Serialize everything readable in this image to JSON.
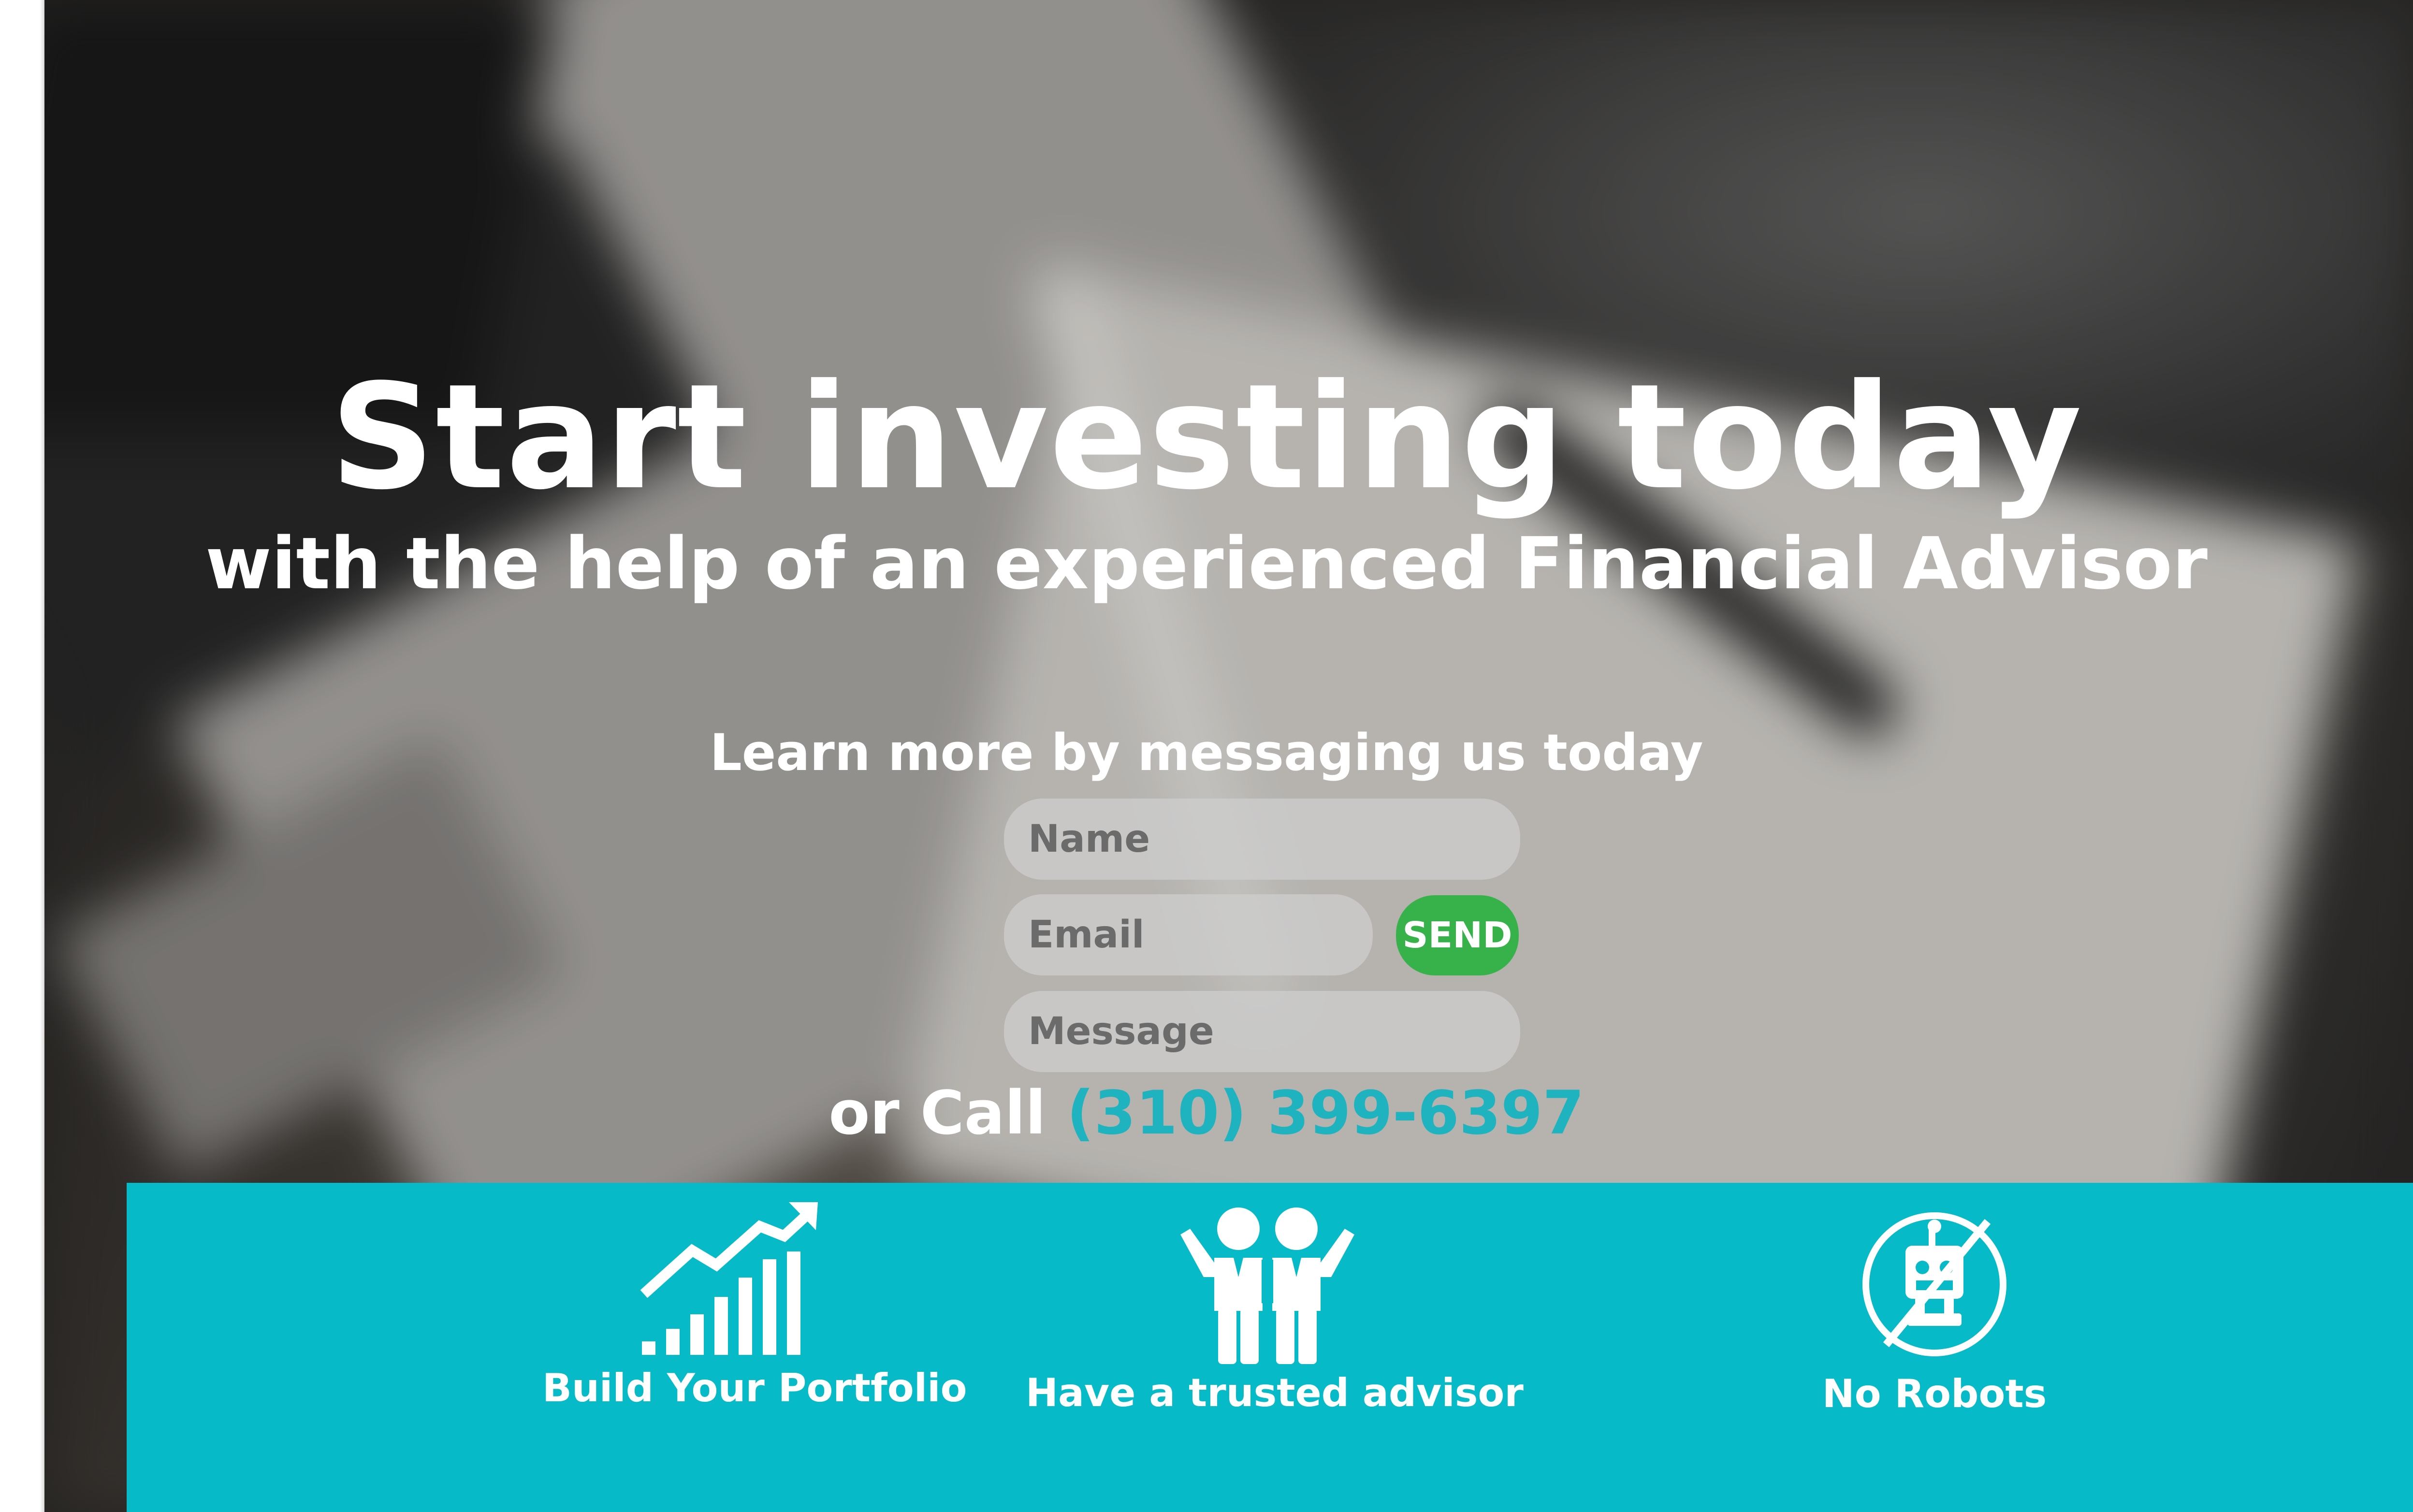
{
  "hero": {
    "headline": "Start investing today",
    "subheadline": "with the help of an experienced Financial Advisor"
  },
  "contact_form": {
    "prompt": "Learn more by messaging us today",
    "name_placeholder": "Name",
    "email_placeholder": "Email",
    "message_placeholder": "Message",
    "send_label": "SEND"
  },
  "call": {
    "prefix": "or Call",
    "phone": "(310) 399-6397"
  },
  "features": [
    {
      "label": "Build Your Portfolio",
      "icon": "growth-chart-icon"
    },
    {
      "label": "Have a trusted advisor",
      "icon": "two-people-icon"
    },
    {
      "label": "No Robots",
      "icon": "no-robot-icon"
    }
  ],
  "colors": {
    "accent_teal": "#06bac7",
    "phone_teal": "#1fb3c0",
    "send_green": "#37b24a",
    "text_white": "#ffffff"
  }
}
